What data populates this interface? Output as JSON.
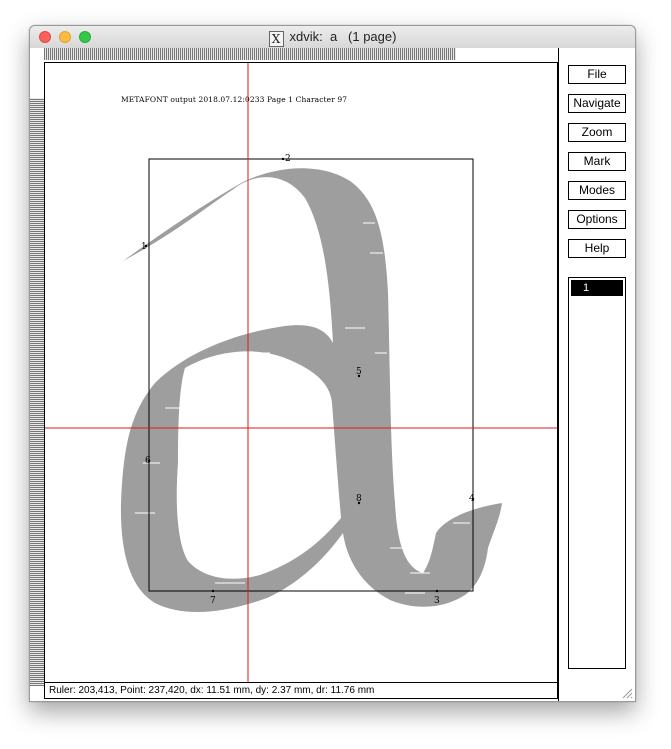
{
  "window": {
    "title": "xdvik:  a   (1 page)",
    "title_icon": "X"
  },
  "page": {
    "header": "METAFONT output 2018.07.12:0233  Page 1  Character 97"
  },
  "glyph": {
    "character": "a",
    "fill_color": "#9e9e9e",
    "ruler_color": "#d81c1c",
    "points": [
      "1",
      "2",
      "3",
      "4",
      "5",
      "6",
      "7",
      "8"
    ]
  },
  "status": {
    "text": "Ruler: 203,413, Point: 237,420, dx: 11.51 mm, dy: 2.37 mm, dr: 11.76 mm"
  },
  "toolbar": {
    "file": "File",
    "navigate": "Navigate",
    "zoom": "Zoom",
    "mark": "Mark",
    "modes": "Modes",
    "options": "Options",
    "help": "Help"
  },
  "pages": {
    "items": [
      "1"
    ],
    "selected": "1"
  }
}
